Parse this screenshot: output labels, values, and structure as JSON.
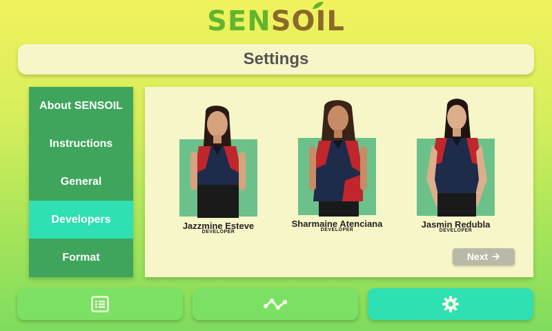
{
  "logo": {
    "part1": "SEN",
    "part2": "S",
    "part3": "O",
    "part4": "IL"
  },
  "header": {
    "title": "Settings"
  },
  "sidebar": {
    "items": [
      {
        "label": "About SENSOIL",
        "active": false
      },
      {
        "label": "Instructions",
        "active": false
      },
      {
        "label": "General",
        "active": false
      },
      {
        "label": "Developers",
        "active": true
      },
      {
        "label": "Format",
        "active": false
      }
    ]
  },
  "developers": [
    {
      "name": "Jazzmine Esteve",
      "role": "DEVELOPER"
    },
    {
      "name": "Sharmaine Atenciana",
      "role": "DEVELOPER"
    },
    {
      "name": "Jasmin Redubla",
      "role": "DEVELOPER"
    }
  ],
  "panel": {
    "next_label": "Next",
    "next_icon": "arrow-right-icon"
  },
  "bottom_nav": [
    {
      "icon": "list-icon",
      "active": false,
      "color": "#7ce064"
    },
    {
      "icon": "chart-line-icon",
      "active": false,
      "color": "#7ce064"
    },
    {
      "icon": "gear-icon",
      "active": true,
      "color": "#2fe0b3"
    }
  ],
  "colors": {
    "sidebar": "#3fa55c",
    "active": "#2fe0b3",
    "panel": "#f7f6c8",
    "brand_green": "#62b52e",
    "brand_brown": "#8a6a2a"
  }
}
